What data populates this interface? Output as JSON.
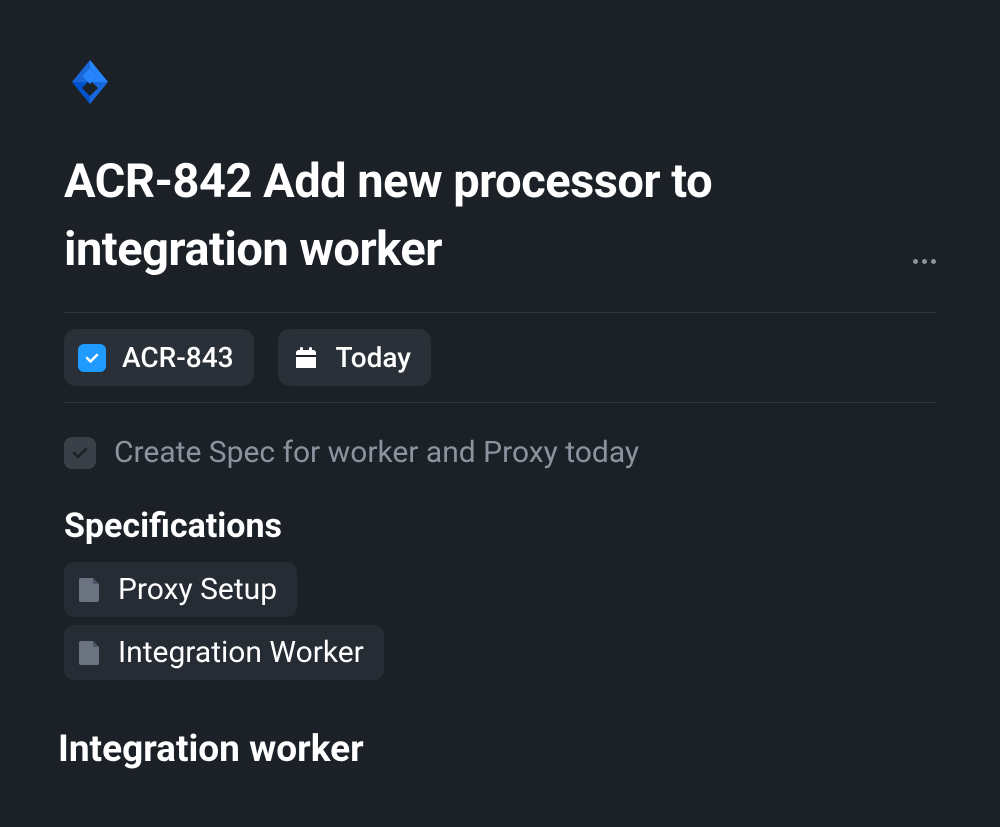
{
  "header": {
    "title": "ACR-842 Add new processor to integration worker"
  },
  "chips": {
    "issue": {
      "label": "ACR-843"
    },
    "date": {
      "label": "Today"
    }
  },
  "todo": {
    "text": "Create Spec for worker and Proxy today",
    "completed": true
  },
  "specifications": {
    "heading": "Specifications",
    "items": [
      {
        "label": "Proxy Setup"
      },
      {
        "label": "Integration Worker"
      }
    ]
  },
  "section": {
    "heading": "Integration worker"
  }
}
